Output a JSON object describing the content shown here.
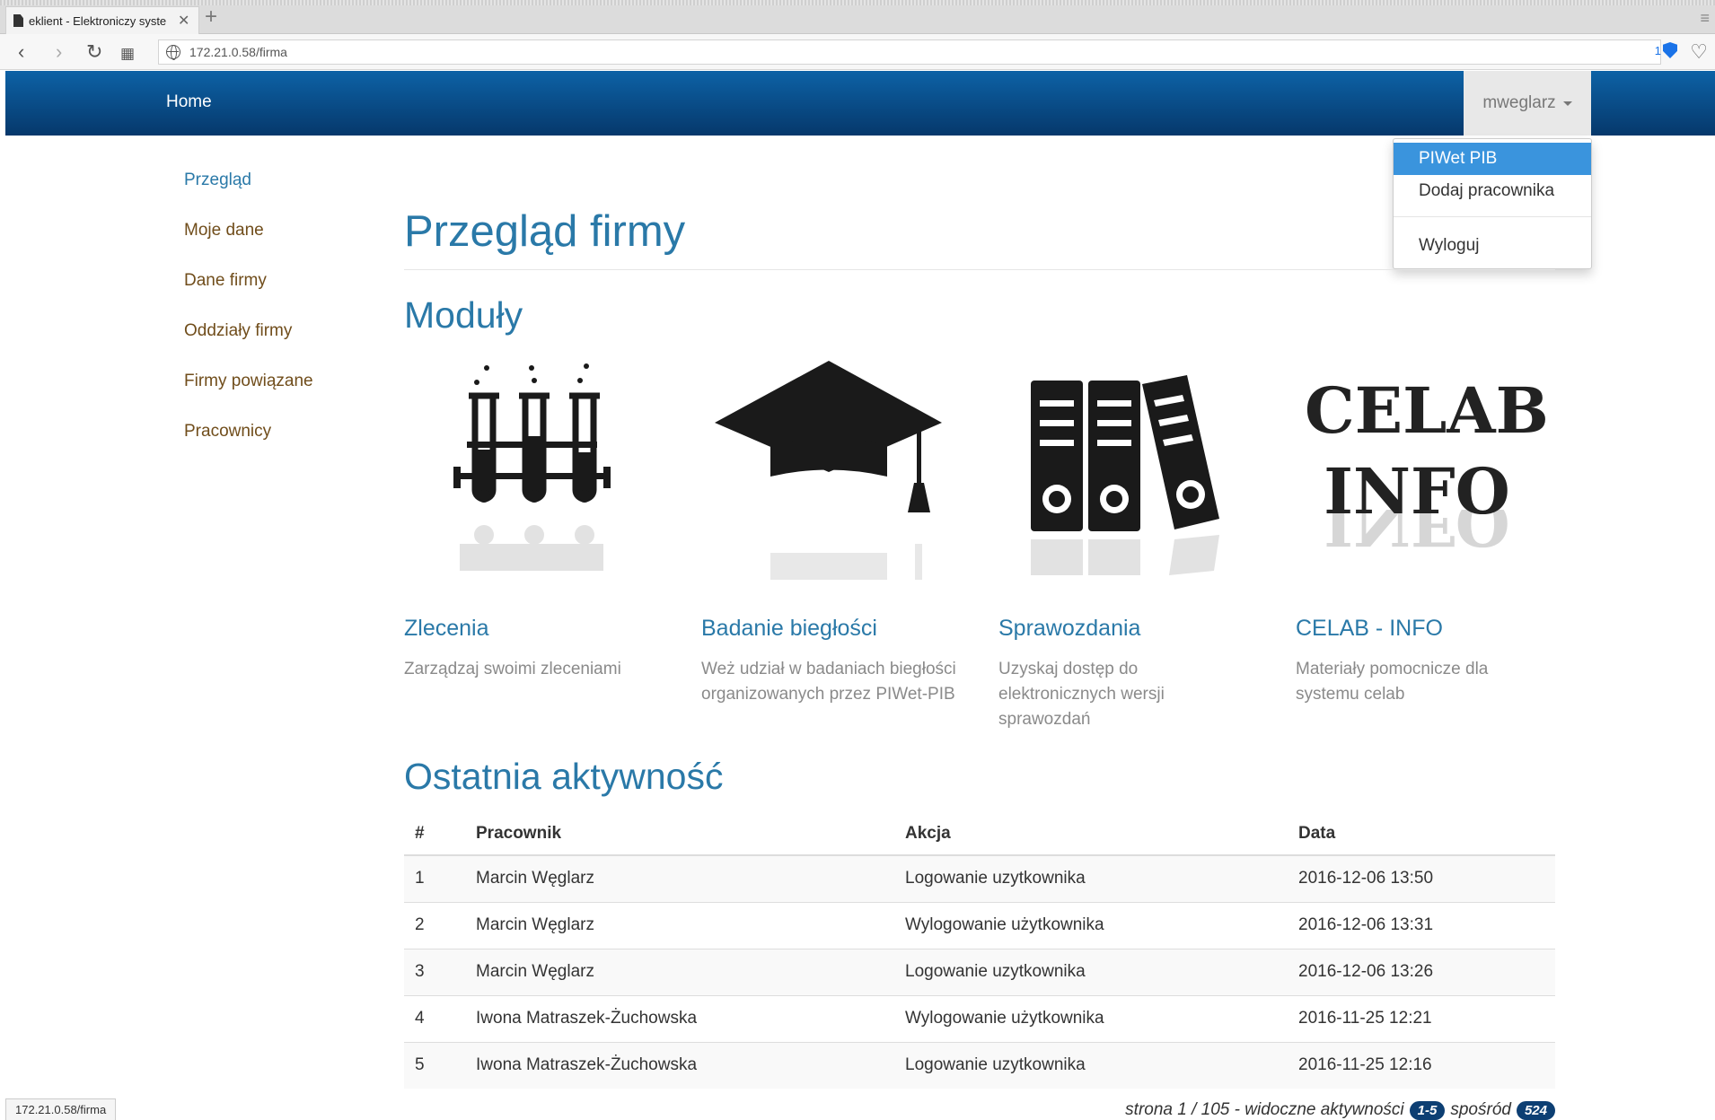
{
  "browser": {
    "tab_title": "eklient - Elektroniczy syste",
    "url": "172.21.0.58/firma",
    "shield_count": "1",
    "status_url": "172.21.0.58/firma"
  },
  "navbar": {
    "brand": "Home",
    "user": "mweglarz"
  },
  "dropdown": {
    "items": [
      {
        "label": "PIWet PIB"
      },
      {
        "label": "Dodaj pracownika"
      },
      {
        "label": "Wyloguj"
      }
    ]
  },
  "sidebar": {
    "items": [
      {
        "label": "Przegląd"
      },
      {
        "label": "Moje dane"
      },
      {
        "label": "Dane firmy"
      },
      {
        "label": "Oddziały firmy"
      },
      {
        "label": "Firmy powiązane"
      },
      {
        "label": "Pracownicy"
      }
    ]
  },
  "main": {
    "page_title": "Przegląd firmy",
    "modules_heading": "Moduły",
    "modules": [
      {
        "title": "Zlecenia",
        "description": "Zarządzaj swoimi zleceniami",
        "icon": "test-tubes-icon"
      },
      {
        "title": "Badanie biegłości",
        "description": "Weż udział w badaniach biegłości organizowanych przez PIWet-PIB",
        "icon": "graduation-cap-icon"
      },
      {
        "title": "Sprawozdania",
        "description": "Uzyskaj dostęp do elektronicznych wersji sprawozdań",
        "icon": "binders-icon"
      },
      {
        "title": "CELAB - INFO",
        "description": "Materiały pomocnicze dla systemu celab",
        "icon": "celab-info-logo",
        "logo_line1": "CELAB",
        "logo_line2": "INFO"
      }
    ],
    "activity_heading": "Ostatnia aktywność",
    "table": {
      "headers": [
        "#",
        "Pracownik",
        "Akcja",
        "Data"
      ],
      "rows": [
        [
          "1",
          "Marcin Węglarz",
          "Logowanie uzytkownika",
          "2016-12-06 13:50"
        ],
        [
          "2",
          "Marcin Węglarz",
          "Wylogowanie użytkownika",
          "2016-12-06 13:31"
        ],
        [
          "3",
          "Marcin Węglarz",
          "Logowanie uzytkownika",
          "2016-12-06 13:26"
        ],
        [
          "4",
          "Iwona Matraszek-Żuchowska",
          "Wylogowanie użytkownika",
          "2016-11-25 12:21"
        ],
        [
          "5",
          "Iwona Matraszek-Żuchowska",
          "Logowanie uzytkownika",
          "2016-11-25 12:16"
        ]
      ]
    },
    "pagination": {
      "prefix": "strona 1 / 105 - widoczne aktywności",
      "range": "1-5",
      "of": "spośród",
      "total": "524"
    }
  },
  "colors": {
    "navbar_top": "#0d62a6",
    "navbar_bottom": "#06386b",
    "link_blue": "#2a79a8",
    "sidebar_brown": "#704d1b",
    "dropdown_active": "#3a94dd",
    "badge": "#0d3f73"
  }
}
